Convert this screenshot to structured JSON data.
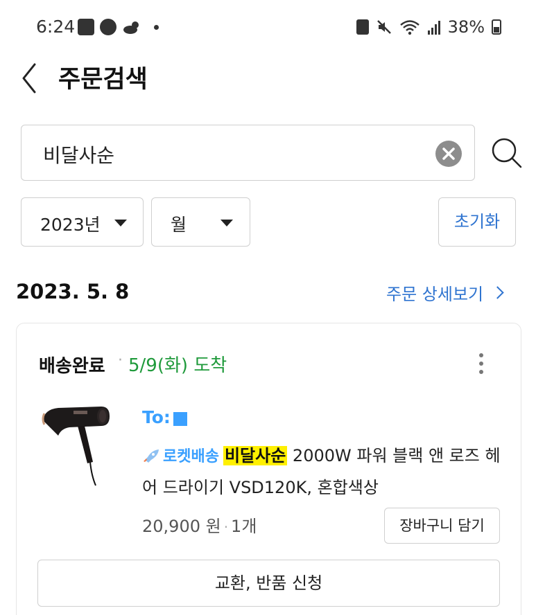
{
  "status_bar": {
    "time": "6:24",
    "battery": "38%",
    "left_icons": [
      "image-icon",
      "alert-icon",
      "weather-icon",
      "dot-icon"
    ],
    "right_icons": [
      "battery-saver-icon",
      "mute-icon",
      "wifi-icon",
      "signal-icon",
      "battery-icon"
    ]
  },
  "header": {
    "title": "주문검색"
  },
  "search": {
    "value": "비달사순"
  },
  "filters": {
    "year": "2023년",
    "month": "월",
    "reset": "초기화"
  },
  "order": {
    "date": "2023. 5. 8",
    "detail_link": "주문 상세보기",
    "delivery_status": "배송완료",
    "separator": "·",
    "arrival": "5/9(화) 도착",
    "to_label": "To:",
    "rocket_label": "로켓배송",
    "highlight": "비달사순",
    "product_rest": " 2000W 파워 블랙 앤 로즈 헤어 드라이기 VSD120K, 혼합색상",
    "price": "20,900 원",
    "quantity": "1개",
    "cart_button": "장바구니 담기",
    "return_button": "교환, 반품 신청"
  },
  "colors": {
    "accent_blue": "#2f74d0",
    "rocket_blue": "#3aa0ff",
    "arrival_green": "#1f9a3b",
    "highlight_yellow": "#fff000"
  }
}
